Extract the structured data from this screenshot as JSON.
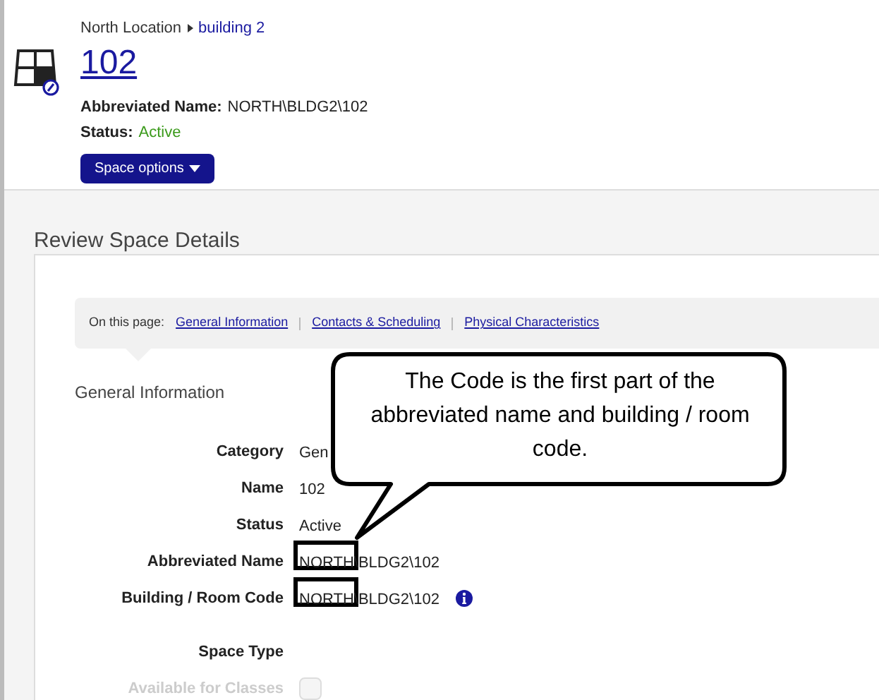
{
  "breadcrumb": [
    {
      "label": "North Location"
    },
    {
      "label": "building 2"
    }
  ],
  "title": "102",
  "summary": [
    {
      "label": "Abbreviated Name:",
      "value": "NORTH\\BLDG2\\102",
      "kind": "plain"
    },
    {
      "label": "Status:",
      "value": "Active",
      "kind": "status"
    }
  ],
  "options_button": "Space options",
  "section_title": "Review Space Details",
  "on_this_page": {
    "label": "On this page:",
    "links": [
      "General Information",
      "Contacts & Scheduling",
      "Physical Characteristics"
    ]
  },
  "group_title": "General Information",
  "fields": [
    {
      "label": "Category",
      "value": "Gen",
      "kind": "text",
      "highlighted": false
    },
    {
      "label": "Name",
      "value": "102",
      "kind": "text",
      "highlighted": false
    },
    {
      "label": "Status",
      "value": "Active",
      "kind": "text",
      "highlighted": false
    },
    {
      "label": "Abbreviated Name",
      "value": "NORTH\\BLDG2\\102",
      "kind": "text",
      "highlighted": true
    },
    {
      "label": "Building / Room Code",
      "value": "NORTH\\BLDG2\\102",
      "kind": "info",
      "highlighted": true
    },
    {
      "label": "Space Type",
      "kind": "gap"
    },
    {
      "label": "Available for Classes",
      "kind": "checkbox",
      "checked": false,
      "disabled": true
    }
  ],
  "callout": "The Code is the first part of the abbreviated name and building / room code."
}
